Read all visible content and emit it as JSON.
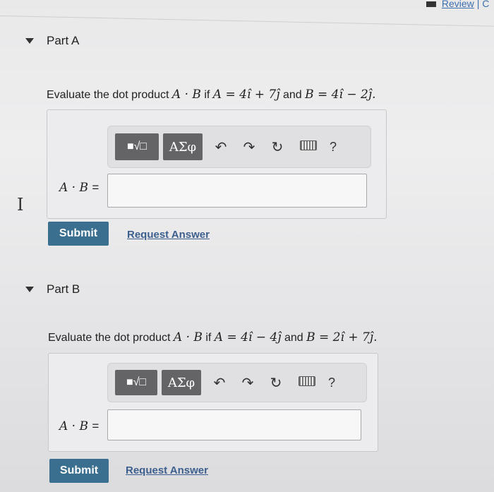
{
  "header": {
    "review_link": "Review",
    "separator": "|",
    "next_link_fragment": "C"
  },
  "parts": [
    {
      "title": "Part A",
      "question_intro": "Evaluate the dot product",
      "question_expr": "A · B",
      "question_if": "if",
      "question_a": "A = 4î + 7ĵ",
      "question_and": "and",
      "question_b": "B = 4î − 2ĵ.",
      "answer_label": "A · B",
      "answer_equals": "=",
      "answer_value": "",
      "submit_label": "Submit",
      "request_label": "Request Answer"
    },
    {
      "title": "Part B",
      "question_intro": "Evaluate the dot product",
      "question_expr": "A · B",
      "question_if": "if",
      "question_a": "A = 4î − 4ĵ",
      "question_and": "and",
      "question_b": "B = 2î + 7ĵ.",
      "answer_label": "A · B",
      "answer_equals": "=",
      "answer_value": "",
      "submit_label": "Submit",
      "request_label": "Request Answer"
    }
  ],
  "toolbar": {
    "templates_icon": "■√□",
    "greek_label": "ΑΣφ",
    "undo_icon": "↶",
    "redo_icon": "↷",
    "reset_icon": "↻",
    "help_label": "?"
  }
}
